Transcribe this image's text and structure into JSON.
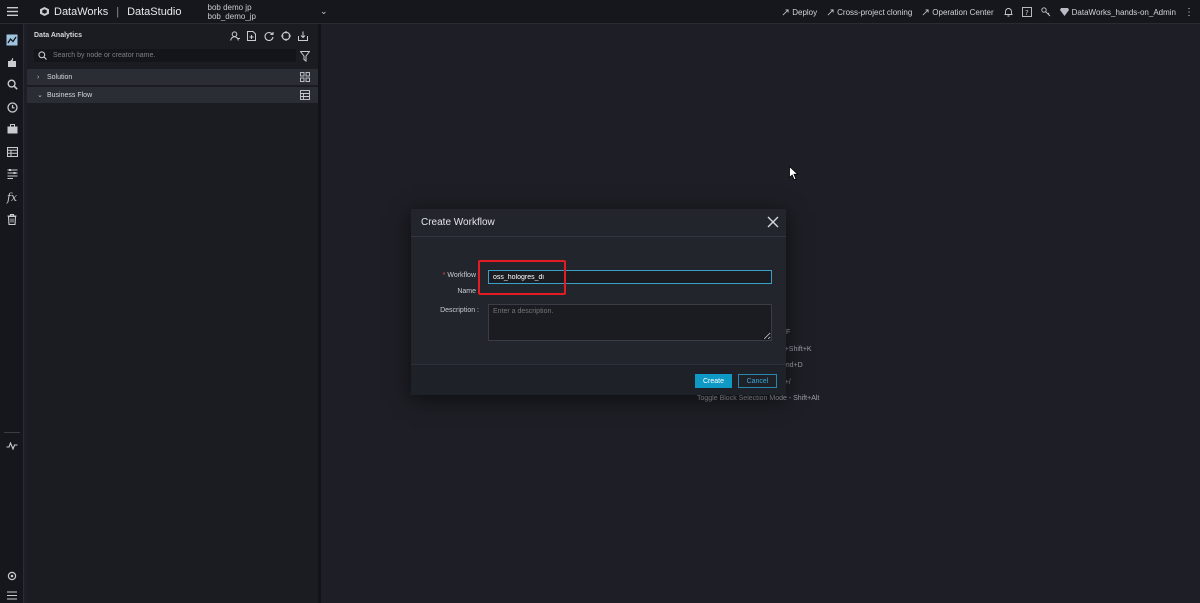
{
  "header": {
    "brand": "DataWorks",
    "module": "DataStudio",
    "workspace_line1": "bob demo jp",
    "workspace_line2": "bob_demo_jp",
    "links": [
      "Deploy",
      "Cross-project cloning",
      "Operation Center"
    ],
    "user": "DataWorks_hands-on_Admin"
  },
  "sidebar": {
    "title": "Data Analytics",
    "search_placeholder": "Search by node or creator name.",
    "tree": [
      {
        "label": "Solution"
      },
      {
        "label": "Business Flow"
      }
    ]
  },
  "background_hints": [
    "F",
    "md+Shift+K",
    "| Cmd+D",
    "md+/",
    "Toggle Block Selection Mode - Shift+Alt"
  ],
  "modal": {
    "title": "Create Workflow",
    "name_label_line1": "Workflow",
    "name_label_line2": "Name",
    "name_required_mark": "*",
    "name_value": "oss_hologres_di",
    "description_label": "Description :",
    "description_placeholder": "Enter a description.",
    "create_label": "Create",
    "cancel_label": "Cancel"
  },
  "colors": {
    "accent": "#0e9ac4",
    "highlight": "#e11d23",
    "background": "#1e1f26"
  }
}
